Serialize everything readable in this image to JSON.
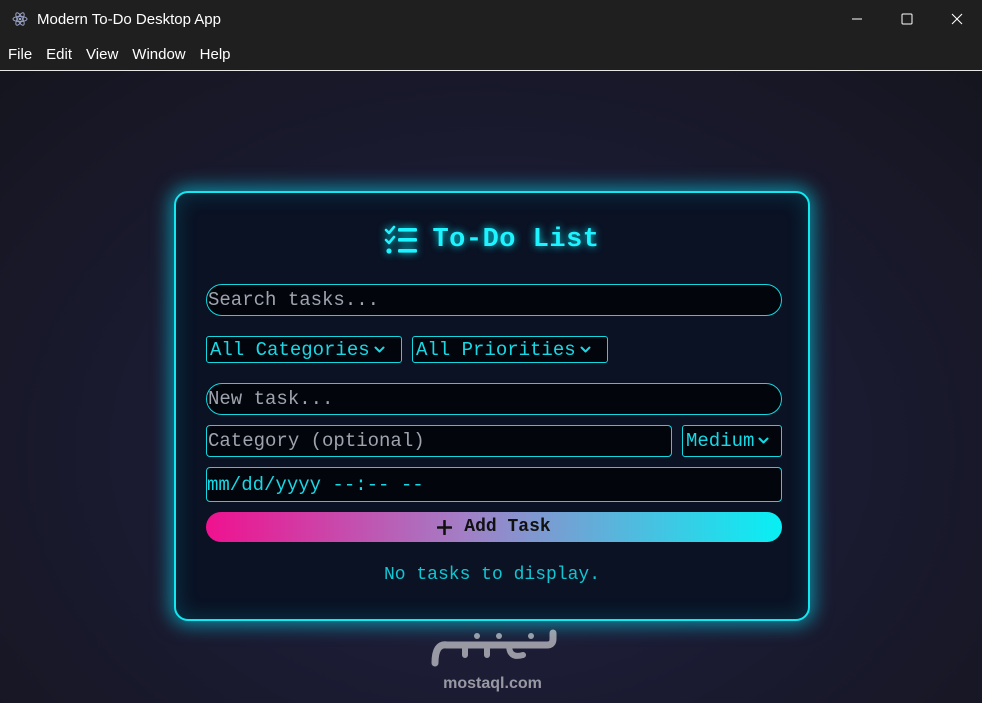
{
  "window": {
    "title": "Modern To-Do Desktop App",
    "app_icon": "electron-icon",
    "controls": [
      "minimize-icon",
      "maximize-icon",
      "close-icon"
    ]
  },
  "menu": {
    "items": [
      "File",
      "Edit",
      "View",
      "Window",
      "Help"
    ]
  },
  "todo": {
    "heading_icon": "checklist-icon",
    "title": "To-Do List",
    "search_placeholder": "Search tasks...",
    "category_filter": "All Categories",
    "priority_filter": "All Priorities",
    "new_task_placeholder": "New task...",
    "category_placeholder": "Category (optional)",
    "priority_value": "Medium",
    "datetime_value": "mm/dd/yyyy --:-- --",
    "add_button_label": "Add Task",
    "empty_message": "No tasks to display."
  },
  "watermark": {
    "brand": "mostaql.com"
  },
  "colors": {
    "accent": "#11e8f0",
    "card_bg": "#0a1224",
    "gradient_start": "#f0118f",
    "gradient_end": "#07f0f4"
  }
}
